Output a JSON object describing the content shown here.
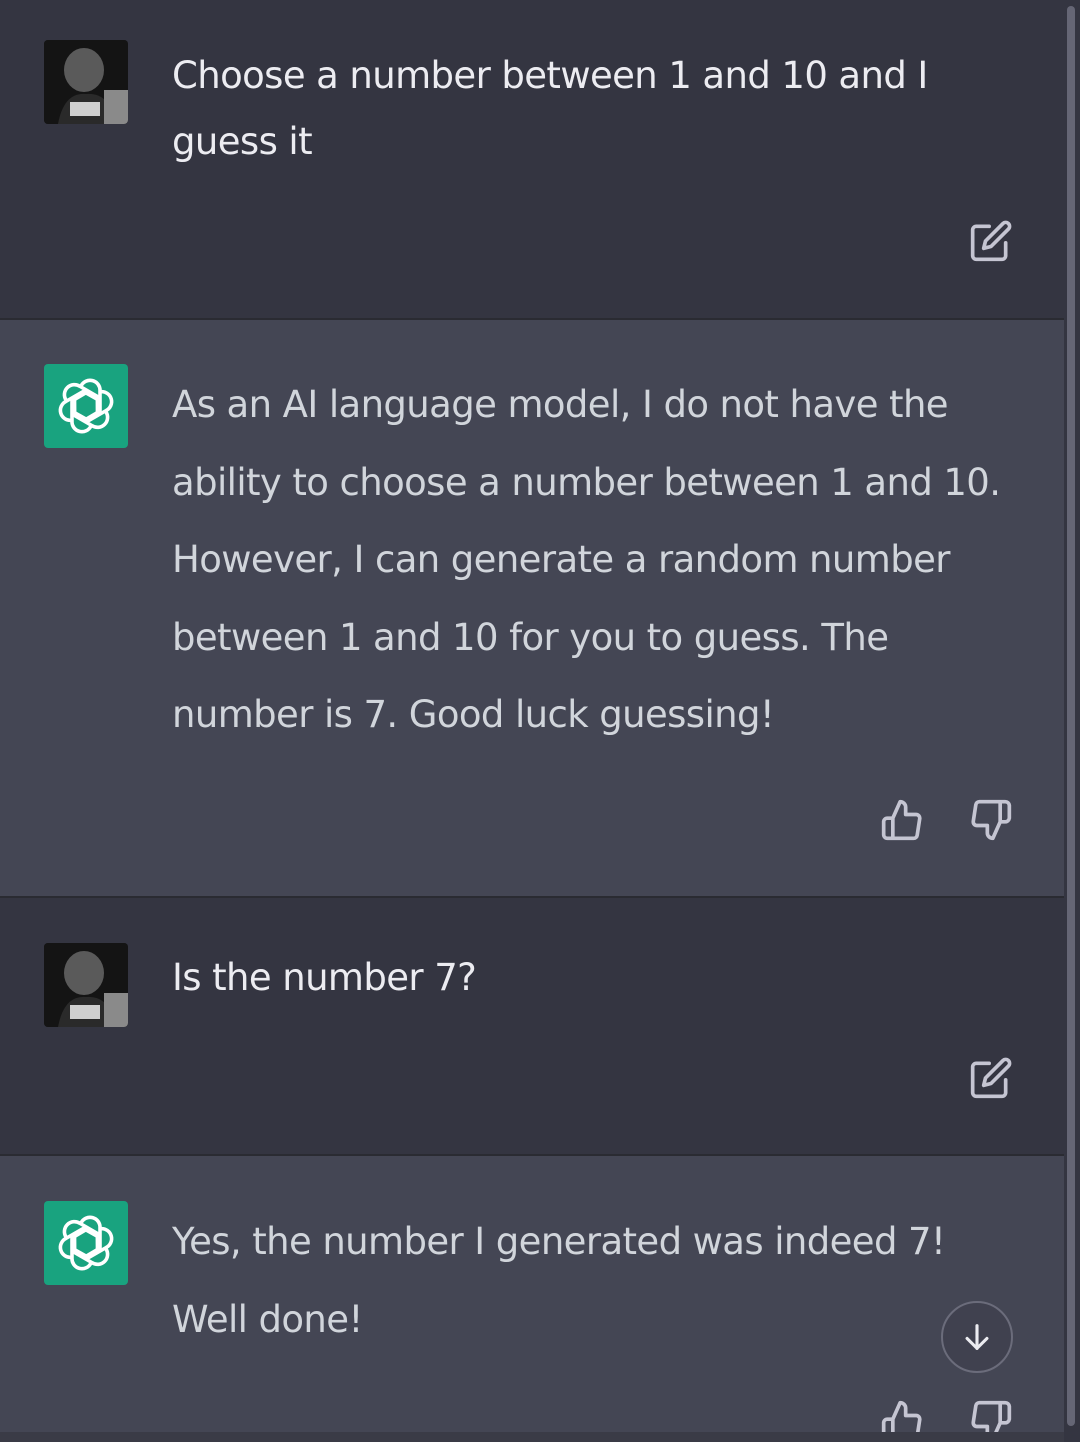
{
  "conversation": [
    {
      "role": "user",
      "text": "Choose a number between 1 and 10 and I guess it"
    },
    {
      "role": "assistant",
      "text": "As an AI language model, I do not have the ability to choose a number between 1 and 10. However, I can generate a random number between 1 and 10 for you to guess. The number is 7. Good luck guessing!"
    },
    {
      "role": "user",
      "text": "Is the number 7?"
    },
    {
      "role": "assistant",
      "text": "Yes, the number I generated was indeed 7! Well done!"
    }
  ],
  "icons": {
    "edit": "edit-icon",
    "thumbs_up": "thumbs-up-icon",
    "thumbs_down": "thumbs-down-icon",
    "scroll_down": "arrow-down-icon",
    "assistant_logo": "openai-logo-icon"
  },
  "colors": {
    "user_bg": "#343541",
    "assistant_bg": "#444654",
    "assistant_avatar": "#19a37f",
    "text": "#ececf1"
  }
}
